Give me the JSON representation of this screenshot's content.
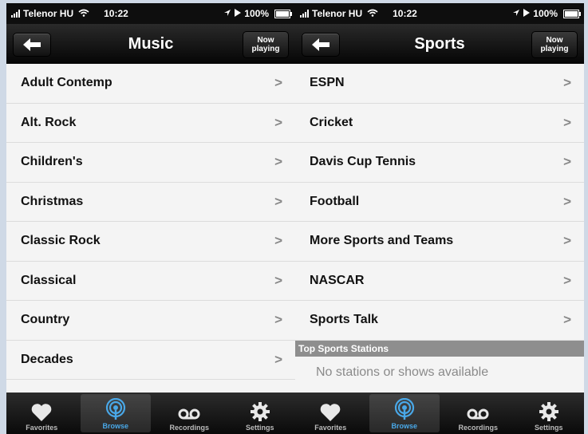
{
  "status_bar": {
    "carrier": "Telenor HU",
    "time": "10:22",
    "battery": "100%"
  },
  "icons": {
    "back": "left-arrow-icon",
    "chevron": "chevron-right-icon",
    "favorites": "heart-icon",
    "browse": "broadcast-icon",
    "recordings": "voicemail-icon",
    "settings": "gear-icon"
  },
  "colors": {
    "nav_bar": "#0a0a0a",
    "active_tab": "#49a8e8",
    "section_header": "#8e8e8e"
  },
  "chevron_glyph": ">",
  "left_screen": {
    "title": "Music",
    "now_playing": {
      "line1": "Now",
      "line2": "playing"
    },
    "items": [
      "Adult Contemp",
      "Alt. Rock",
      "Children's",
      "Christmas",
      "Classic Rock",
      "Classical",
      "Country",
      "Decades"
    ]
  },
  "right_screen": {
    "title": "Sports",
    "now_playing": {
      "line1": "Now",
      "line2": "playing"
    },
    "items": [
      "ESPN",
      "Cricket",
      "Davis Cup Tennis",
      "Football",
      "More Sports and Teams",
      "NASCAR",
      "Sports Talk"
    ],
    "section_header": "Top Sports Stations",
    "empty_message": "No stations or shows available"
  },
  "tab_bar": {
    "favorites": "Favorites",
    "browse": "Browse",
    "recordings": "Recordings",
    "settings": "Settings"
  }
}
